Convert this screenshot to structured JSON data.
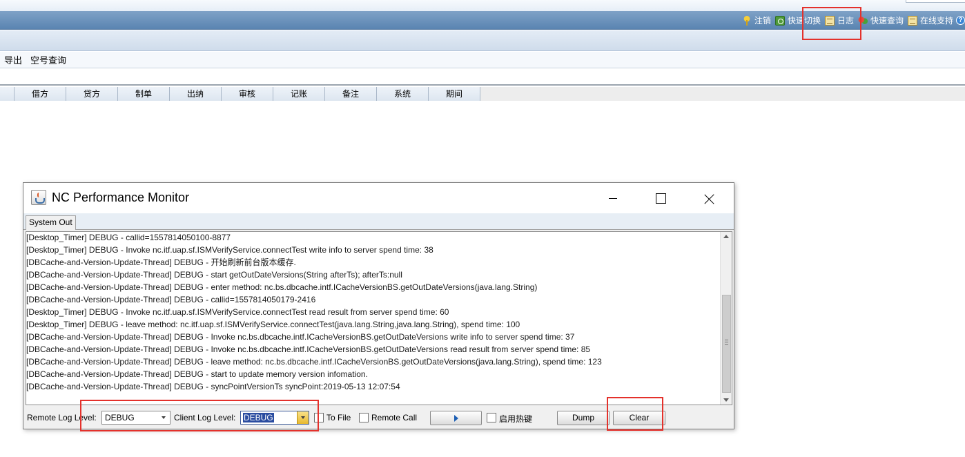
{
  "app": {
    "top_links": [
      {
        "label": "注销",
        "icon": "key-icon"
      },
      {
        "label": "快速切换",
        "icon": "switch-icon"
      },
      {
        "label": "日志",
        "icon": "log-icon"
      },
      {
        "label": "快速查询",
        "icon": "quick-query-icon"
      },
      {
        "label": "在线支持",
        "icon": "online-support-icon"
      }
    ],
    "menu": [
      "导出",
      "空号查询"
    ],
    "columns": [
      "借方",
      "贷方",
      "制单",
      "出纳",
      "审核",
      "记账",
      "备注",
      "系统",
      "期间"
    ]
  },
  "window": {
    "title": "NC Performance Monitor",
    "tab": "System Out",
    "log_lines": [
      "[Desktop_Timer] DEBUG - callid=1557814050100-8877",
      "[Desktop_Timer] DEBUG - Invoke nc.itf.uap.sf.ISMVerifyService.connectTest write info to server spend time: 38",
      "[DBCache-and-Version-Update-Thread] DEBUG - 开始刷新前台版本缓存.",
      "[DBCache-and-Version-Update-Thread] DEBUG - start getOutDateVersions(String afterTs); afterTs:null",
      "[DBCache-and-Version-Update-Thread] DEBUG - enter method: nc.bs.dbcache.intf.ICacheVersionBS.getOutDateVersions(java.lang.String)",
      "[DBCache-and-Version-Update-Thread] DEBUG - callid=1557814050179-2416",
      "[Desktop_Timer] DEBUG - Invoke nc.itf.uap.sf.ISMVerifyService.connectTest read result from server spend time: 60",
      "[Desktop_Timer] DEBUG - leave method: nc.itf.uap.sf.ISMVerifyService.connectTest(java.lang.String,java.lang.String), spend time: 100",
      "[DBCache-and-Version-Update-Thread] DEBUG - Invoke nc.bs.dbcache.intf.ICacheVersionBS.getOutDateVersions write info to server spend time: 37",
      "[DBCache-and-Version-Update-Thread] DEBUG - Invoke nc.bs.dbcache.intf.ICacheVersionBS.getOutDateVersions read result from server spend time: 85",
      "[DBCache-and-Version-Update-Thread] DEBUG - leave method: nc.bs.dbcache.intf.ICacheVersionBS.getOutDateVersions(java.lang.String), spend time: 123",
      "[DBCache-and-Version-Update-Thread] DEBUG - start to update memory version infomation.",
      "[DBCache-and-Version-Update-Thread] DEBUG - syncPointVersionTs syncPoint:2019-05-13 12:07:54"
    ],
    "controls": {
      "remote_log_level_label": "Remote Log Level:",
      "remote_log_level_value": "DEBUG",
      "client_log_level_label": "Client Log Level:",
      "client_log_level_value": "DEBUG",
      "to_file_label": "To File",
      "remote_call_label": "Remote Call",
      "hotkey_label": "启用热键",
      "dump_label": "Dump",
      "clear_label": "Clear"
    }
  },
  "colors": {
    "highlight": "#e4312b",
    "header_blue": "#6a91bc"
  }
}
